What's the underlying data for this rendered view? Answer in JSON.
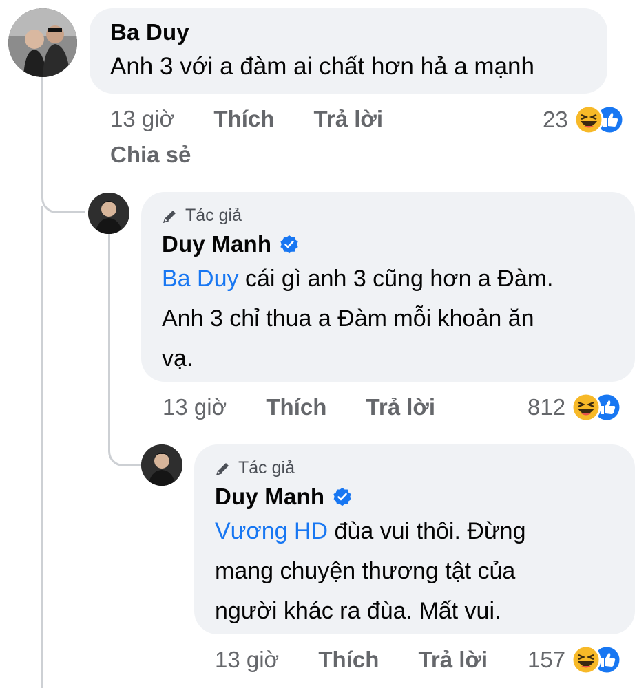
{
  "comment": {
    "author": "Ba Duy",
    "text": "Anh 3 với a đàm ai chất hơn hả a mạnh",
    "time": "13 giờ",
    "like_label": "Thích",
    "reply_label": "Trả lời",
    "share_label": "Chia sẻ",
    "reaction_count": "23",
    "reaction_icons": [
      "haha-icon",
      "like-icon"
    ]
  },
  "replies": [
    {
      "author_tag": "Tác giả",
      "author": "Duy Manh",
      "verified": true,
      "mention": "Ba Duy",
      "text_line1": " cái gì anh 3 cũng hơn a Đàm.",
      "text_line2": "Anh 3 chỉ thua a Đàm mỗi khoản ăn",
      "text_line3": "vạ.",
      "time": "13 giờ",
      "like_label": "Thích",
      "reply_label": "Trả lời",
      "reaction_count": "812",
      "reaction_icons": [
        "haha-icon",
        "like-icon"
      ]
    },
    {
      "author_tag": "Tác giả",
      "author": "Duy Manh",
      "verified": true,
      "mention": "Vương HD",
      "text_line1": " đùa vui thôi. Đừng",
      "text_line2": "mang chuyện thương tật của",
      "text_line3": "người khác ra đùa. Mất vui.",
      "time": "13 giờ",
      "like_label": "Thích",
      "reply_label": "Trả lời",
      "reaction_count": "157",
      "reaction_icons": [
        "haha-icon",
        "like-icon"
      ]
    }
  ],
  "colors": {
    "bubble": "#f0f2f5",
    "mention": "#1877f2",
    "meta": "#65676b",
    "like_blue": "#1877f2",
    "haha_yellow": "#f7b928"
  }
}
